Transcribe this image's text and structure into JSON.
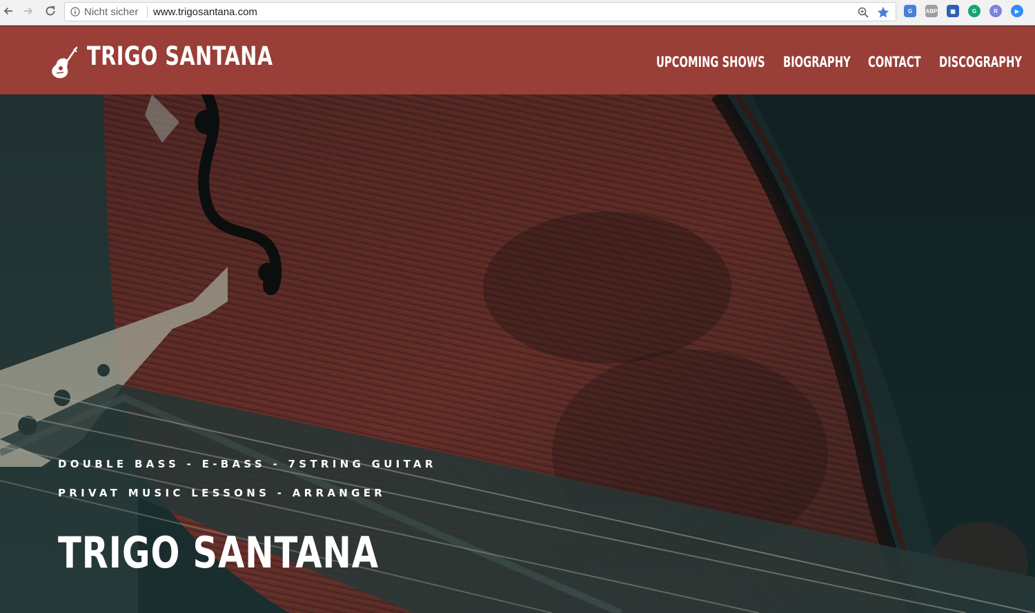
{
  "browser": {
    "security_label": "Nicht sicher",
    "url": "www.trigosantana.com",
    "extensions": [
      {
        "name": "google-translate-icon",
        "color": "#4a7fd9",
        "text": "G"
      },
      {
        "name": "adblock-plus-icon",
        "color": "#9e9e9e",
        "text": "ABP"
      },
      {
        "name": "grid-extension-icon",
        "color": "#2f5fb5",
        "text": "▦"
      },
      {
        "name": "grammarly-icon",
        "color": "#15a571",
        "text": "G"
      },
      {
        "name": "r-extension-icon",
        "color": "#7b83e0",
        "text": "R"
      },
      {
        "name": "zoom-extension-icon",
        "color": "#2d8cff",
        "text": "▶"
      }
    ],
    "accent_color": "#4a7fd9"
  },
  "site": {
    "logo_text": "TRIGO SANTANA",
    "header_color": "#993f37",
    "nav": [
      {
        "label": "UPCOMING SHOWS"
      },
      {
        "label": "BIOGRAPHY"
      },
      {
        "label": "CONTACT"
      },
      {
        "label": "DISCOGRAPHY"
      }
    ]
  },
  "hero": {
    "tagline_1": "DOUBLE BASS - E-BASS - 7STRING GUITAR",
    "tagline_2": "PRIVAT MUSIC LESSONS - ARRANGER",
    "title": "TRIGO SANTANA"
  }
}
